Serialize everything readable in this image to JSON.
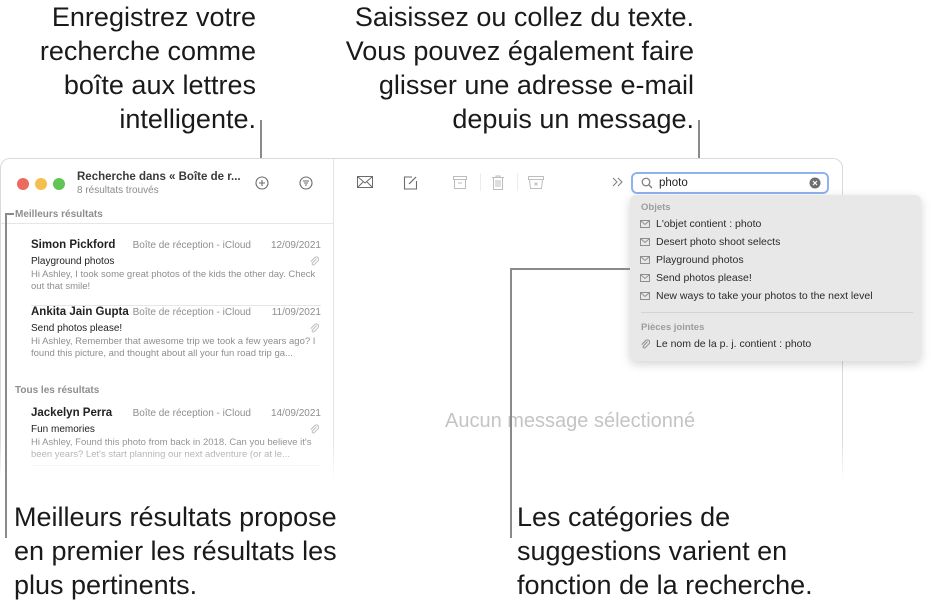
{
  "callouts": {
    "smart_mailbox": [
      "Enregistrez votre",
      "recherche comme",
      "boîte aux lettres",
      "intelligente."
    ],
    "search_field": [
      "Saisissez ou collez du texte.",
      "Vous pouvez également faire",
      "glisser une adresse e-mail",
      "depuis un message."
    ],
    "top_hits": [
      "Meilleurs résultats propose",
      "en premier les résultats les",
      "plus pertinents."
    ],
    "categories": [
      "Les catégories de",
      "suggestions varient en",
      "fonction de la recherche."
    ]
  },
  "sidebar": {
    "title": "Recherche dans « Boîte de r...",
    "subtitle": "8 résultats trouvés",
    "top_hits_label": "Meilleurs résultats",
    "all_results_label": "Tous les résultats",
    "messages": [
      {
        "from": "Simon Pickford",
        "mailbox": "Boîte de réception - iCloud",
        "date": "12/09/2021",
        "subject": "Playground photos",
        "preview": "Hi Ashley, I took some great photos of the kids the other day. Check out that smile!",
        "attachment": true
      },
      {
        "from": "Ankita Jain Gupta",
        "mailbox": "Boîte de réception - iCloud",
        "date": "11/09/2021",
        "subject": "Send photos please!",
        "preview": "Hi Ashley, Remember that awesome trip we took a few years ago? I found this picture, and thought about all your fun road trip ga...",
        "attachment": true
      },
      {
        "from": "Jackelyn Perra",
        "mailbox": "Boîte de réception - iCloud",
        "date": "14/09/2021",
        "subject": "Fun memories",
        "preview": "Hi Ashley, Found this photo from back in 2018. Can you believe it's been years? Let's start planning our next adventure (or at le...",
        "attachment": true
      }
    ]
  },
  "toolbar": {
    "icons": [
      "add-smart-mailbox-icon",
      "filter-icon",
      "get-mail-icon",
      "compose-icon",
      "archive-icon",
      "trash-icon",
      "junk-icon",
      "more-chevron-icon"
    ]
  },
  "search": {
    "value": "photo",
    "icon": "search-icon",
    "clear_icon": "clear-icon"
  },
  "suggestions": {
    "subjects_header": "Objets",
    "subjects": [
      "L'objet contient : photo",
      "Desert photo shoot selects",
      "Playground photos",
      "Send photos please!",
      "New ways to take your photos to the next level"
    ],
    "attachments_header": "Pièces jointes",
    "attachments": [
      "Le nom de la p. j. contient : photo"
    ]
  },
  "viewer": {
    "empty_label": "Aucun message sélectionné"
  },
  "colors": {
    "search_focus": "#8fb3f0",
    "close": "#ec6a5e",
    "minimize": "#f4bf4f",
    "zoom": "#61c554"
  }
}
